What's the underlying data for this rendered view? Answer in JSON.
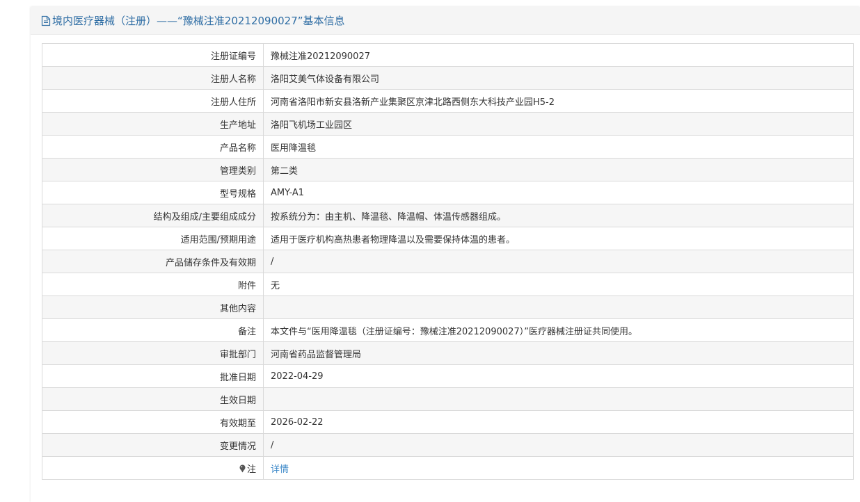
{
  "header": {
    "title": "境内医疗器械（注册）——“豫械注准20212090027”基本信息"
  },
  "colors": {
    "header_text": "#2e6da4",
    "link": "#3a87c8",
    "row_alt": "#f6f6f6",
    "border": "#d9d9d9"
  },
  "rows": [
    {
      "label": "注册证编号",
      "value": "豫械注准20212090027"
    },
    {
      "label": "注册人名称",
      "value": "洛阳艾美气体设备有限公司"
    },
    {
      "label": "注册人住所",
      "value": "河南省洛阳市新安县洛新产业集聚区京津北路西侧东大科技产业园H5-2"
    },
    {
      "label": "生产地址",
      "value": "洛阳飞机场工业园区"
    },
    {
      "label": "产品名称",
      "value": "医用降温毯"
    },
    {
      "label": "管理类别",
      "value": "第二类"
    },
    {
      "label": "型号规格",
      "value": "AMY-A1"
    },
    {
      "label": "结构及组成/主要组成成分",
      "value": "按系统分为：由主机、降温毯、降温帽、体温传感器组成。"
    },
    {
      "label": "适用范围/预期用途",
      "value": "适用于医疗机构高热患者物理降温以及需要保持体温的患者。"
    },
    {
      "label": "产品储存条件及有效期",
      "value": "/"
    },
    {
      "label": "附件",
      "value": "无"
    },
    {
      "label": "其他内容",
      "value": ""
    },
    {
      "label": "备注",
      "value": "本文件与“医用降温毯（注册证编号：豫械注准20212090027）”医疗器械注册证共同使用。"
    },
    {
      "label": "审批部门",
      "value": "河南省药品监督管理局"
    },
    {
      "label": "批准日期",
      "value": "2022-04-29"
    },
    {
      "label": "生效日期",
      "value": ""
    },
    {
      "label": "有效期至",
      "value": "2026-02-22"
    },
    {
      "label": "变更情况",
      "value": "/"
    }
  ],
  "note_row": {
    "label": "注",
    "icon": "pin-icon",
    "link": "详情"
  }
}
